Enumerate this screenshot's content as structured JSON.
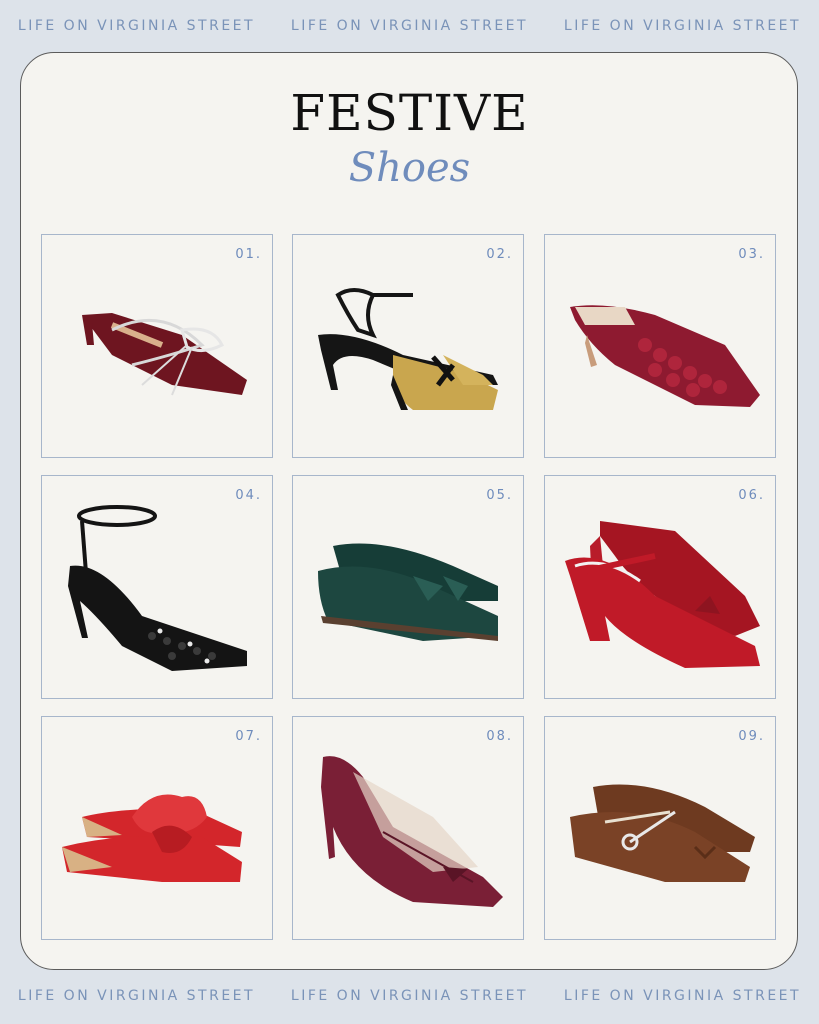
{
  "banner": {
    "top": [
      "LIFE ON VIRGINIA STREET",
      "LIFE ON VIRGINIA STREET",
      "LIFE ON VIRGINIA STREET"
    ],
    "bottom": [
      "LIFE ON VIRGINIA STREET",
      "LIFE ON VIRGINIA STREET",
      "LIFE ON VIRGINIA STREET"
    ]
  },
  "title": "FESTIVE",
  "subtitle": "Shoes",
  "products": [
    {
      "number": "01.",
      "icon": "burgundy-velvet-bow-mule-icon",
      "color": "#6e1520"
    },
    {
      "number": "02.",
      "icon": "black-gold-glitter-slingback-icon",
      "color": "#c9a64e"
    },
    {
      "number": "03.",
      "icon": "red-sequin-mule-icon",
      "color": "#8e1a30"
    },
    {
      "number": "04.",
      "icon": "black-embellished-ankle-strap-pump-icon",
      "color": "#141414"
    },
    {
      "number": "05.",
      "icon": "green-velvet-tassel-loafer-icon",
      "color": "#1d4740"
    },
    {
      "number": "06.",
      "icon": "red-patent-mary-jane-heel-icon",
      "color": "#c01a28"
    },
    {
      "number": "07.",
      "icon": "red-bow-flat-mule-icon",
      "color": "#d3262b"
    },
    {
      "number": "08.",
      "icon": "burgundy-mesh-slingback-icon",
      "color": "#7a1f36"
    },
    {
      "number": "09.",
      "icon": "brown-suede-ballet-flat-icon",
      "color": "#7a4226"
    }
  ]
}
